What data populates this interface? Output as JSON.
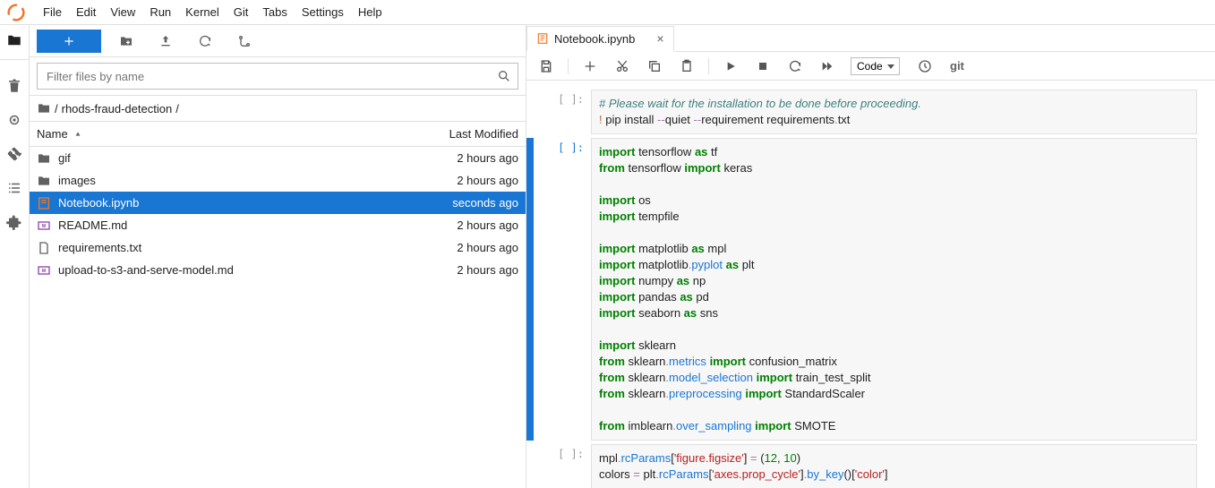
{
  "menu": [
    "File",
    "Edit",
    "View",
    "Run",
    "Kernel",
    "Git",
    "Tabs",
    "Settings",
    "Help"
  ],
  "filter": {
    "placeholder": "Filter files by name"
  },
  "breadcrumb": {
    "path": "rhods-fraud-detection",
    "sep": "/"
  },
  "columns": {
    "name": "Name",
    "modified": "Last Modified"
  },
  "files": [
    {
      "type": "folder",
      "name": "gif",
      "modified": "2 hours ago",
      "selected": false
    },
    {
      "type": "folder",
      "name": "images",
      "modified": "2 hours ago",
      "selected": false
    },
    {
      "type": "notebook",
      "name": "Notebook.ipynb",
      "modified": "seconds ago",
      "selected": true
    },
    {
      "type": "markdown",
      "name": "README.md",
      "modified": "2 hours ago",
      "selected": false
    },
    {
      "type": "file",
      "name": "requirements.txt",
      "modified": "2 hours ago",
      "selected": false
    },
    {
      "type": "markdown",
      "name": "upload-to-s3-and-serve-model.md",
      "modified": "2 hours ago",
      "selected": false
    }
  ],
  "tab": {
    "title": "Notebook.ipynb"
  },
  "toolbar": {
    "cell_type": "Code",
    "git_label": "git"
  },
  "cells": [
    {
      "prompt": "[ ]:",
      "active": false,
      "tokens": [
        {
          "t": "# Please wait for the installation to be done before proceeding.",
          "c": "cm"
        },
        {
          "t": "\n"
        },
        {
          "t": "!",
          "c": "bang"
        },
        {
          "t": " pip install "
        },
        {
          "t": "--",
          "c": "op"
        },
        {
          "t": "quiet "
        },
        {
          "t": "--",
          "c": "op"
        },
        {
          "t": "requirement requirements"
        },
        {
          "t": ".",
          "c": "op"
        },
        {
          "t": "txt"
        }
      ]
    },
    {
      "prompt": "[ ]:",
      "active": true,
      "tokens": [
        {
          "t": "import",
          "c": "kw"
        },
        {
          "t": " tensorflow "
        },
        {
          "t": "as",
          "c": "kw"
        },
        {
          "t": " tf\n"
        },
        {
          "t": "from",
          "c": "kw"
        },
        {
          "t": " tensorflow "
        },
        {
          "t": "import",
          "c": "kw"
        },
        {
          "t": " keras\n\n"
        },
        {
          "t": "import",
          "c": "kw"
        },
        {
          "t": " os\n"
        },
        {
          "t": "import",
          "c": "kw"
        },
        {
          "t": " tempfile\n\n"
        },
        {
          "t": "import",
          "c": "kw"
        },
        {
          "t": " matplotlib "
        },
        {
          "t": "as",
          "c": "kw"
        },
        {
          "t": " mpl\n"
        },
        {
          "t": "import",
          "c": "kw"
        },
        {
          "t": " matplotlib"
        },
        {
          "t": ".",
          "c": "op"
        },
        {
          "t": "pyplot",
          "c": "attr"
        },
        {
          "t": " "
        },
        {
          "t": "as",
          "c": "kw"
        },
        {
          "t": " plt\n"
        },
        {
          "t": "import",
          "c": "kw"
        },
        {
          "t": " numpy "
        },
        {
          "t": "as",
          "c": "kw"
        },
        {
          "t": " np\n"
        },
        {
          "t": "import",
          "c": "kw"
        },
        {
          "t": " pandas "
        },
        {
          "t": "as",
          "c": "kw"
        },
        {
          "t": " pd\n"
        },
        {
          "t": "import",
          "c": "kw"
        },
        {
          "t": " seaborn "
        },
        {
          "t": "as",
          "c": "kw"
        },
        {
          "t": " sns\n\n"
        },
        {
          "t": "import",
          "c": "kw"
        },
        {
          "t": " sklearn\n"
        },
        {
          "t": "from",
          "c": "kw"
        },
        {
          "t": " sklearn"
        },
        {
          "t": ".",
          "c": "op"
        },
        {
          "t": "metrics",
          "c": "attr"
        },
        {
          "t": " "
        },
        {
          "t": "import",
          "c": "kw"
        },
        {
          "t": " confusion_matrix\n"
        },
        {
          "t": "from",
          "c": "kw"
        },
        {
          "t": " sklearn"
        },
        {
          "t": ".",
          "c": "op"
        },
        {
          "t": "model_selection",
          "c": "attr"
        },
        {
          "t": " "
        },
        {
          "t": "import",
          "c": "kw"
        },
        {
          "t": " train_test_split\n"
        },
        {
          "t": "from",
          "c": "kw"
        },
        {
          "t": " sklearn"
        },
        {
          "t": ".",
          "c": "op"
        },
        {
          "t": "preprocessing",
          "c": "attr"
        },
        {
          "t": " "
        },
        {
          "t": "import",
          "c": "kw"
        },
        {
          "t": " StandardScaler\n\n"
        },
        {
          "t": "from",
          "c": "kw"
        },
        {
          "t": " imblearn"
        },
        {
          "t": ".",
          "c": "op"
        },
        {
          "t": "over_sampling",
          "c": "attr"
        },
        {
          "t": " "
        },
        {
          "t": "import",
          "c": "kw"
        },
        {
          "t": " SMOTE"
        }
      ]
    },
    {
      "prompt": "[ ]:",
      "active": false,
      "tokens": [
        {
          "t": "mpl"
        },
        {
          "t": ".",
          "c": "op"
        },
        {
          "t": "rcParams",
          "c": "attr"
        },
        {
          "t": "["
        },
        {
          "t": "'figure.figsize'",
          "c": "str"
        },
        {
          "t": "] "
        },
        {
          "t": "=",
          "c": "op"
        },
        {
          "t": " ("
        },
        {
          "t": "12",
          "c": "num"
        },
        {
          "t": ", "
        },
        {
          "t": "10",
          "c": "num"
        },
        {
          "t": ")\n"
        },
        {
          "t": "colors "
        },
        {
          "t": "=",
          "c": "op"
        },
        {
          "t": " plt"
        },
        {
          "t": ".",
          "c": "op"
        },
        {
          "t": "rcParams",
          "c": "attr"
        },
        {
          "t": "["
        },
        {
          "t": "'axes.prop_cycle'",
          "c": "str"
        },
        {
          "t": "]"
        },
        {
          "t": ".",
          "c": "op"
        },
        {
          "t": "by_key",
          "c": "attr"
        },
        {
          "t": "()["
        },
        {
          "t": "'color'",
          "c": "str"
        },
        {
          "t": "]"
        }
      ]
    }
  ]
}
